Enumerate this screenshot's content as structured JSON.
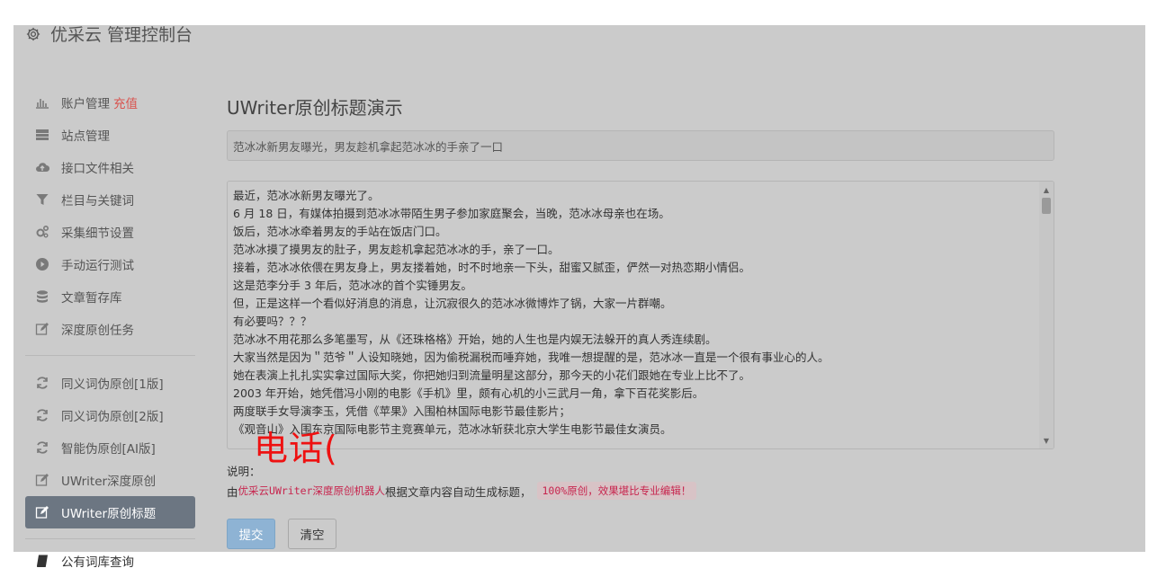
{
  "brand": {
    "title": "优采云 管理控制台"
  },
  "sidebar": {
    "items": [
      {
        "label": "账户管理",
        "tag": "充值",
        "icon": "bar-chart-icon"
      },
      {
        "label": "站点管理",
        "icon": "server-icon"
      },
      {
        "label": "接口文件相关",
        "icon": "cloud-upload-icon"
      },
      {
        "label": "栏目与关键词",
        "icon": "filter-icon"
      },
      {
        "label": "采集细节设置",
        "icon": "gears-icon"
      },
      {
        "label": "手动运行测试",
        "icon": "play-circle-icon"
      },
      {
        "label": "文章暂存库",
        "icon": "database-icon"
      },
      {
        "label": "深度原创任务",
        "icon": "edit-icon"
      }
    ],
    "items2": [
      {
        "label": "同义词伪原创[1版]",
        "icon": "refresh-icon"
      },
      {
        "label": "同义词伪原创[2版]",
        "icon": "refresh-icon"
      },
      {
        "label": "智能伪原创[AI版]",
        "icon": "refresh-icon"
      },
      {
        "label": "UWriter深度原创",
        "icon": "edit-icon"
      },
      {
        "label": "UWriter原创标题",
        "icon": "edit-icon",
        "active": true
      }
    ],
    "items3": [
      {
        "label": "公有词库查询",
        "icon": "book-icon"
      }
    ]
  },
  "main": {
    "heading": "UWriter原创标题演示",
    "title_value": "范冰冰新男友曝光，男友趁机拿起范冰冰的手亲了一口",
    "content_lines": [
      "最近，范冰冰新男友曝光了。",
      "6 月 18 日，有媒体拍摄到范冰冰带陌生男子参加家庭聚会，当晚，范冰冰母亲也在场。",
      "饭后，范冰冰牵着男友的手站在饭店门口。",
      "范冰冰摸了摸男友的肚子，男友趁机拿起范冰冰的手，亲了一口。",
      "接着，范冰冰依偎在男友身上，男友搂着她，时不时地亲一下头，甜蜜又腻歪，俨然一对热恋期小情侣。",
      "这是范李分手 3 年后，范冰冰的首个实锤男友。",
      "但，正是这样一个看似好消息的消息，让沉寂很久的范冰冰微博炸了锅，大家一片群嘲。",
      "有必要吗？？？",
      "范冰冰不用花那么多笔墨写，从《还珠格格》开始，她的人生也是内娱无法躲开的真人秀连续剧。",
      "大家当然是因为＂范爷＂人设知晓她，因为偷税漏税而唾弃她，我唯一想提醒的是，范冰冰一直是一个很有事业心的人。",
      "她在表演上扎扎实实拿过国际大奖，你把她归到流量明星这部分，那今天的小花们跟她在专业上比不了。",
      "2003 年开始，她凭借冯小刚的电影《手机》里，颇有心机的小三武月一角，拿下百花奖影后。",
      "两度联手女导演李玉，凭借《苹果》入围柏林国际电影节最佳影片；",
      "《观音山》入围东京国际电影节主竞赛单元，范冰冰斩获北京大学生电影节最佳女演员。"
    ],
    "overlay_text": "电话(",
    "notes_label": "说明：",
    "notes_prefix": "由 ",
    "notes_code": "优采云UWriter深度原创机器人",
    "notes_middle": " 根据文章内容自动生成标题，",
    "notes_highlight": "100%原创，效果堪比专业编辑！",
    "submit_label": "提交",
    "clear_label": "清空"
  },
  "colors": {
    "accent_tag": "#d9534f",
    "active_nav": "#6c7682",
    "submit_button": "#8eb3d4",
    "code_pink": "#c7254e",
    "overlay_red": "#ee1111"
  }
}
